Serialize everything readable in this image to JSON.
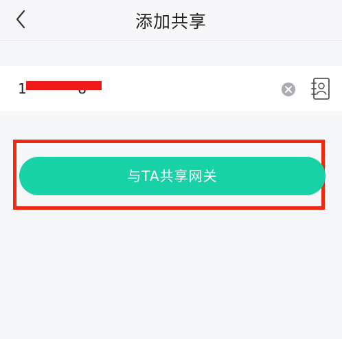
{
  "navbar": {
    "title": "添加共享",
    "back_icon": "chevron-left-icon"
  },
  "form": {
    "phone_value": "1          8",
    "clear_icon": "clear-circle-icon",
    "contacts_icon": "contacts-book-icon"
  },
  "actions": {
    "share_label": "与TA共享网关"
  },
  "colors": {
    "accent": "#16d2a6",
    "highlight": "#f02a10",
    "redaction": "#f01818"
  }
}
